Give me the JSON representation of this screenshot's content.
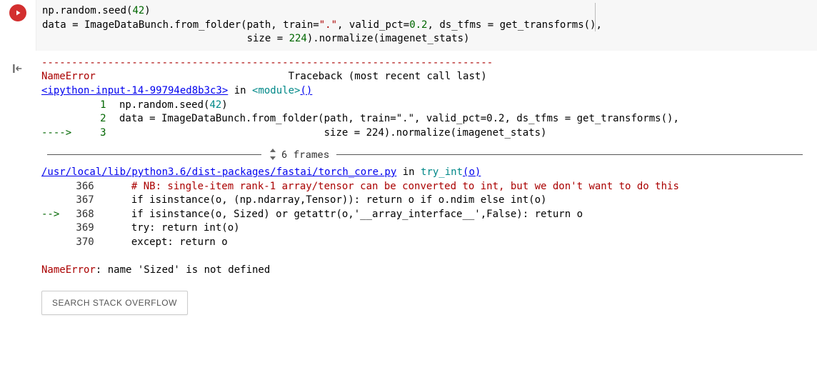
{
  "input": {
    "line1_pre": "np.random.seed(",
    "line1_num": "42",
    "line1_post": ")",
    "line2_a": "data = ImageDataBunch.from_folder(path, train=",
    "line2_str": "\".\"",
    "line2_b": ", valid_pct=",
    "line2_num1": "0.2",
    "line2_c": ", ds_tfms = get_transforms(),",
    "line3_a": "                                  size = ",
    "line3_num": "224",
    "line3_b": ").normalize(imagenet_stats)"
  },
  "output": {
    "dashes": "---------------------------------------------------------------------------",
    "err_name": "NameError",
    "traceback_label": "                                Traceback (most recent call last)",
    "link1": "<ipython-input-14-99794ed8b3c3>",
    "in_label": " in ",
    "module_label": "<module>",
    "paren": "()",
    "src_lineno1": "1",
    "src_line1_a": " np.random.seed(",
    "src_line1_num": "42",
    "src_line1_b": ")",
    "src_lineno2": "2",
    "src_line2": " data = ImageDataBunch.from_folder(path, train=\".\", valid_pct=0.2, ds_tfms = get_transforms(),",
    "arrow1": "----> ",
    "src_lineno3": "3",
    "src_line3": "                                   size = 224).normalize(imagenet_stats)",
    "frames_label": "6 frames",
    "link2": "/usr/local/lib/python3.6/dist-packages/fastai/torch_core.py",
    "in_label2": " in ",
    "fn2": "try_int",
    "fn2_paren": "(o)",
    "tl1_no": "366",
    "tl1": "     # NB: single-item rank-1 array/tensor can be converted to int, but we don't want to do this",
    "tl2_no": "367",
    "tl2": "     if isinstance(o, (np.ndarray,Tensor)): return o if o.ndim else int(o)",
    "arrow2": "--> ",
    "tl3_no": "368",
    "tl3": "     if isinstance(o, Sized) or getattr(o,'__array_interface__',False): return o",
    "tl4_no": "369",
    "tl4": "     try: return int(o)",
    "tl5_no": "370",
    "tl5": "     except: return o",
    "final_err": "NameError",
    "final_msg": ": name 'Sized' is not defined",
    "search_btn": "SEARCH STACK OVERFLOW"
  }
}
